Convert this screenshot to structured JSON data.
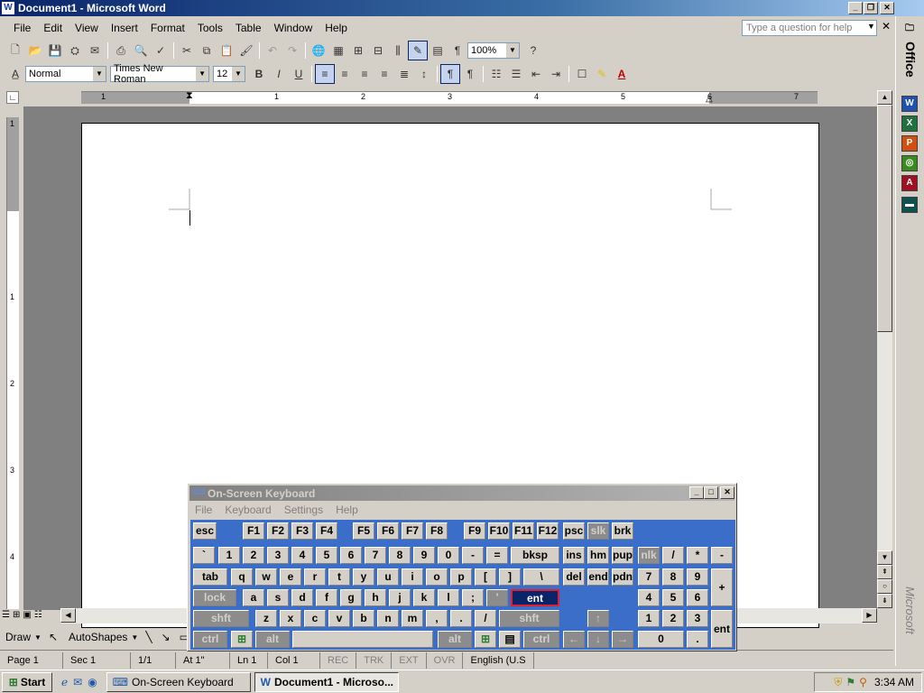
{
  "window": {
    "title": "Document1 - Microsoft Word",
    "app_icon": "W"
  },
  "menubar": [
    "File",
    "Edit",
    "View",
    "Insert",
    "Format",
    "Tools",
    "Table",
    "Window",
    "Help"
  ],
  "askbox": {
    "placeholder": "Type a question for help"
  },
  "toolbar": {
    "zoom": "100%",
    "style": "Normal",
    "font": "Times New Roman",
    "size": "12"
  },
  "ruler": {
    "numbers": [
      "1",
      "1",
      "2",
      "3",
      "4",
      "5",
      "6",
      "7"
    ]
  },
  "vruler": {
    "numbers": [
      "1",
      "1",
      "2",
      "3",
      "4"
    ]
  },
  "office_bar": {
    "label": "Office",
    "brand": "Microsoft"
  },
  "drawbar": {
    "draw": "Draw",
    "autoshapes": "AutoShapes"
  },
  "status": {
    "page": "Page  1",
    "sec": "Sec  1",
    "pages": "1/1",
    "at": "At  1\"",
    "ln": "Ln  1",
    "col": "Col  1",
    "rec": "REC",
    "trk": "TRK",
    "ext": "EXT",
    "ovr": "OVR",
    "lang": "English (U.S"
  },
  "osk": {
    "title": "On-Screen Keyboard",
    "menu": [
      "File",
      "Keyboard",
      "Settings",
      "Help"
    ],
    "row0": [
      "esc",
      "F1",
      "F2",
      "F3",
      "F4",
      "F5",
      "F6",
      "F7",
      "F8",
      "F9",
      "F10",
      "F11",
      "F12",
      "psc",
      "slk",
      "brk"
    ],
    "row1": [
      "`",
      "1",
      "2",
      "3",
      "4",
      "5",
      "6",
      "7",
      "8",
      "9",
      "0",
      "-",
      "=",
      "bksp",
      "ins",
      "hm",
      "pup",
      "nlk",
      "/",
      "*",
      "-"
    ],
    "row2": [
      "tab",
      "q",
      "w",
      "e",
      "r",
      "t",
      "y",
      "u",
      "i",
      "o",
      "p",
      "[",
      "]",
      "\\",
      "del",
      "end",
      "pdn",
      "7",
      "8",
      "9",
      "+"
    ],
    "row3": [
      "lock",
      "a",
      "s",
      "d",
      "f",
      "g",
      "h",
      "j",
      "k",
      "l",
      ";",
      "'",
      "ent",
      "4",
      "5",
      "6"
    ],
    "row4": [
      "shft",
      "z",
      "x",
      "c",
      "v",
      "b",
      "n",
      "m",
      ",",
      ".",
      "/",
      "shft",
      "↑",
      "1",
      "2",
      "3",
      "ent"
    ],
    "row5": [
      "ctrl",
      "alt",
      "alt",
      "ctrl",
      "←",
      "↓",
      "→",
      "0",
      "."
    ]
  },
  "taskbar": {
    "start": "Start",
    "tasks": [
      "On-Screen Keyboard",
      "Document1 - Microso..."
    ],
    "clock": "3:34 AM"
  }
}
